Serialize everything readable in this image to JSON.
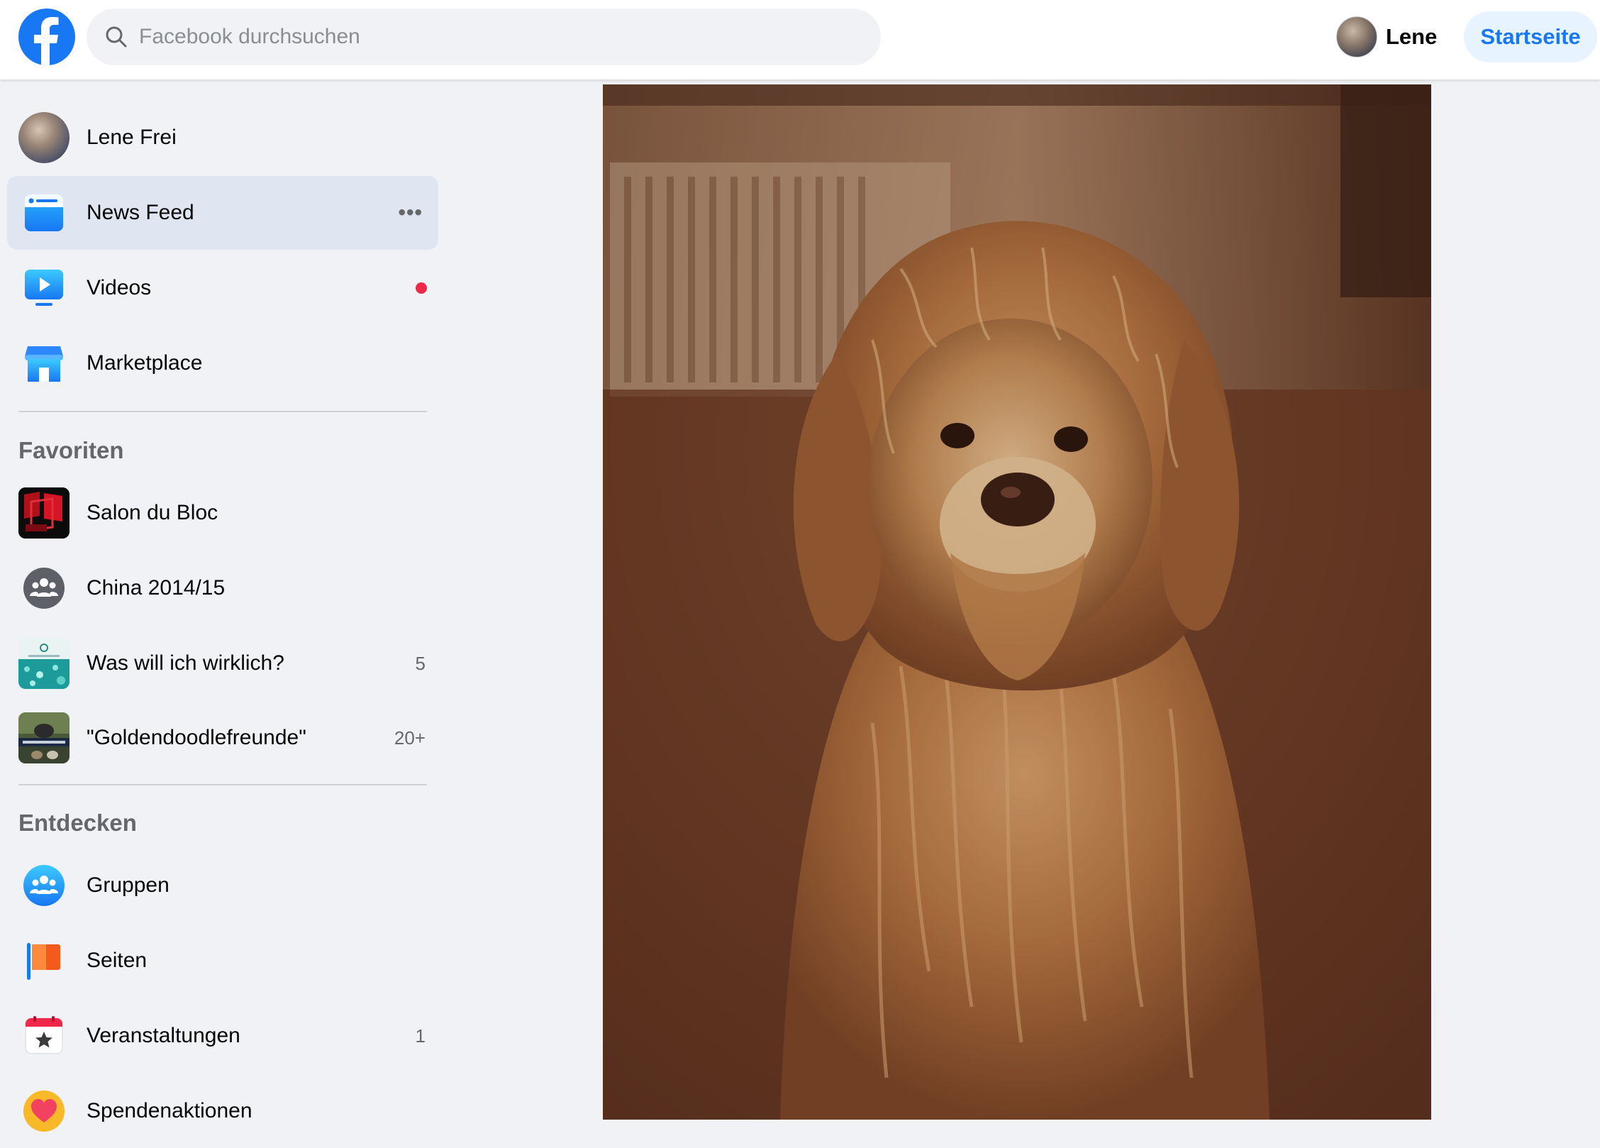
{
  "header": {
    "search_placeholder": "Facebook durchsuchen",
    "profile_name": "Lene",
    "home_label": "Startseite"
  },
  "sidebar": {
    "profile": {
      "label": "Lene Frei"
    },
    "main_items": [
      {
        "label": "News Feed",
        "icon": "news-feed-icon",
        "active": true,
        "more": "•••"
      },
      {
        "label": "Videos",
        "icon": "video-icon",
        "notification_dot": true
      },
      {
        "label": "Marketplace",
        "icon": "marketplace-icon"
      }
    ],
    "favorites_title": "Favoriten",
    "favorites": [
      {
        "label": "Salon du Bloc",
        "icon": "salon-du-bloc-thumbnail",
        "count": ""
      },
      {
        "label": "China 2014/15",
        "icon": "group-icon",
        "count": ""
      },
      {
        "label": "Was will ich wirklich?",
        "icon": "group-thumbnail",
        "count": "5"
      },
      {
        "label": "\"Goldendoodlefreunde\"",
        "icon": "group-thumbnail",
        "count": "20+"
      }
    ],
    "discover_title": "Entdecken",
    "discover": [
      {
        "label": "Gruppen",
        "icon": "groups-icon",
        "count": ""
      },
      {
        "label": "Seiten",
        "icon": "pages-flag-icon",
        "count": ""
      },
      {
        "label": "Veranstaltungen",
        "icon": "events-calendar-icon",
        "count": "1"
      },
      {
        "label": "Spendenaktionen",
        "icon": "fundraiser-heart-icon",
        "count": ""
      }
    ]
  },
  "main": {
    "photo": {
      "subject": "dog-photo"
    }
  },
  "colors": {
    "brand": "#1877f2",
    "active_bg": "#dfe5f1",
    "notification": "#f02849",
    "page_bg": "#f0f2f5"
  }
}
